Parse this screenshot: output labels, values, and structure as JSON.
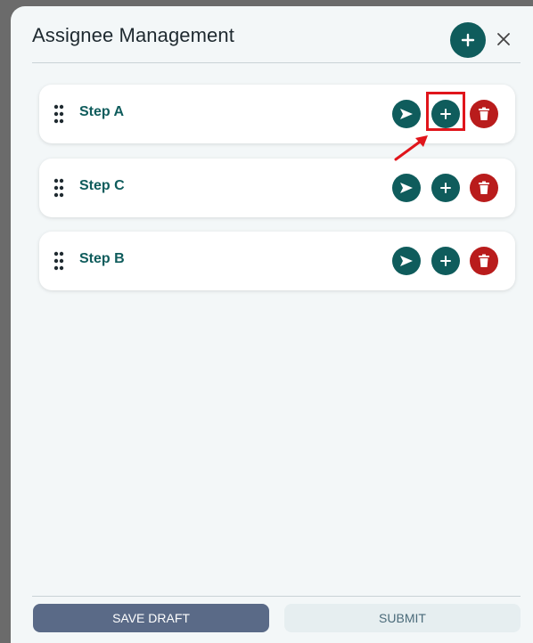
{
  "dialog": {
    "title": "Assignee Management",
    "add_icon": "plus-icon",
    "close_icon": "close-icon"
  },
  "steps": [
    {
      "label": "Step A",
      "highlighted_action": "add"
    },
    {
      "label": "Step C"
    },
    {
      "label": "Step B"
    }
  ],
  "step_actions": {
    "send_icon": "send-icon",
    "add_icon": "plus-icon",
    "delete_icon": "trash-icon",
    "drag_icon": "drag-handle-icon"
  },
  "footer": {
    "save_draft_label": "SAVE DRAFT",
    "submit_label": "SUBMIT"
  },
  "colors": {
    "primary": "#0f5c5c",
    "danger": "#b91c1c",
    "save_button": "#5a6a87",
    "annotation": "#e0151b"
  }
}
